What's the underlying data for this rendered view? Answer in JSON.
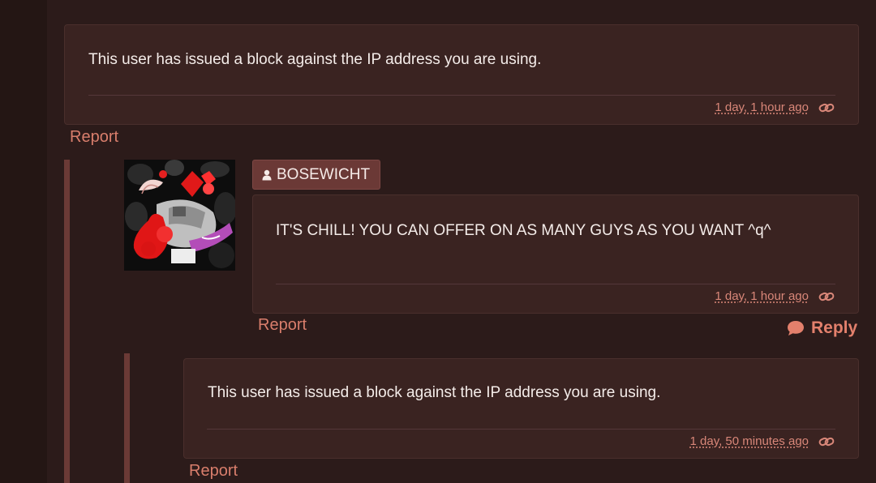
{
  "comments": [
    {
      "text": "This user has issued a block against the IP address you are using.",
      "timestamp": "1 day, 1 hour ago",
      "report_label": "Report"
    },
    {
      "username": "BOSEWICHT",
      "text": "IT'S CHILL! YOU CAN OFFER ON AS MANY GUYS AS YOU WANT ^q^",
      "timestamp": "1 day, 1 hour ago",
      "report_label": "Report",
      "reply_label": "Reply"
    },
    {
      "text": "This user has issued a block against the IP address you are using.",
      "timestamp": "1 day, 50 minutes ago",
      "report_label": "Report"
    }
  ],
  "icons": {
    "permalink": "link-icon",
    "user": "user-icon",
    "reply": "speech-bubble-icon"
  },
  "colors": {
    "background": "#2c1b1a",
    "panel": "#3a2321",
    "accent": "#d97e6c",
    "thread_bar": "#6b3a36",
    "username_badge": "#6b3936"
  }
}
